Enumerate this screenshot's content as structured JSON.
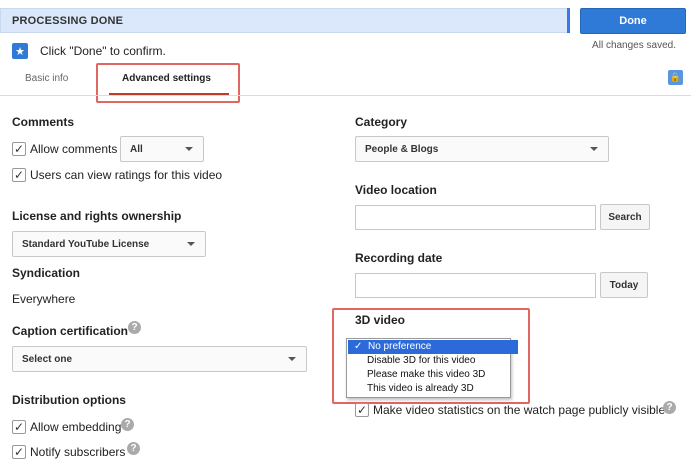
{
  "header": {
    "status": "PROCESSING DONE",
    "done_label": "Done",
    "saved_text": "All changes saved.",
    "confirm_text": "Click \"Done\" to confirm.",
    "star_icon": "★"
  },
  "tabs": {
    "basic": "Basic info",
    "advanced": "Advanced settings",
    "lock_icon": "🔒"
  },
  "left": {
    "comments_title": "Comments",
    "allow_comments": "Allow comments",
    "comments_select": "All",
    "ratings": "Users can view ratings for this video",
    "license_title": "License and rights ownership",
    "license_select": "Standard YouTube License",
    "syndication_title": "Syndication",
    "syndication_value": "Everywhere",
    "caption_title": "Caption certification",
    "caption_select": "Select one",
    "distribution_title": "Distribution options",
    "allow_embedding": "Allow embedding",
    "notify_subscribers": "Notify subscribers"
  },
  "right": {
    "category_title": "Category",
    "category_select": "People & Blogs",
    "location_title": "Video location",
    "search_label": "Search",
    "recording_title": "Recording date",
    "today_label": "Today",
    "video3d_title": "3D video",
    "options3d": [
      "No preference",
      "Disable 3D for this video",
      "Please make this video 3D",
      "This video is already 3D"
    ],
    "selected_check": "✓",
    "stats_public": "Make video statistics on the watch page publicly visible"
  },
  "help_glyph": "?",
  "checkmark": "✓"
}
